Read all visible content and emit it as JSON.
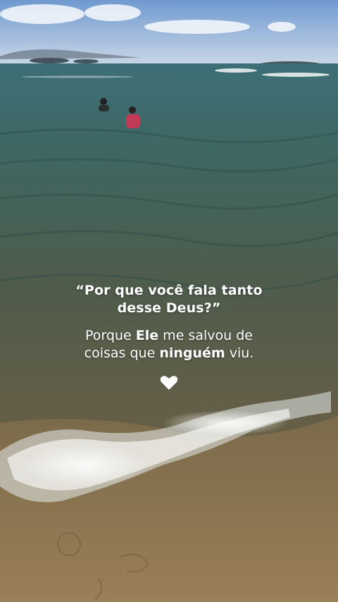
{
  "quote": {
    "question_line1": "“Por que você fala tanto",
    "question_line2": "desse Deus?”",
    "answer_part1": "Porque ",
    "answer_bold1": "Ele",
    "answer_part2": " me salvou de",
    "answer_part3": "coisas que ",
    "answer_bold2": "ninguém",
    "answer_part4": " viu."
  },
  "heart_icon": "heart-icon",
  "colors": {
    "text": "#ffffff",
    "sky": "#8fb1d8",
    "sea": "#3f6a66",
    "sand": "#8a7450"
  }
}
